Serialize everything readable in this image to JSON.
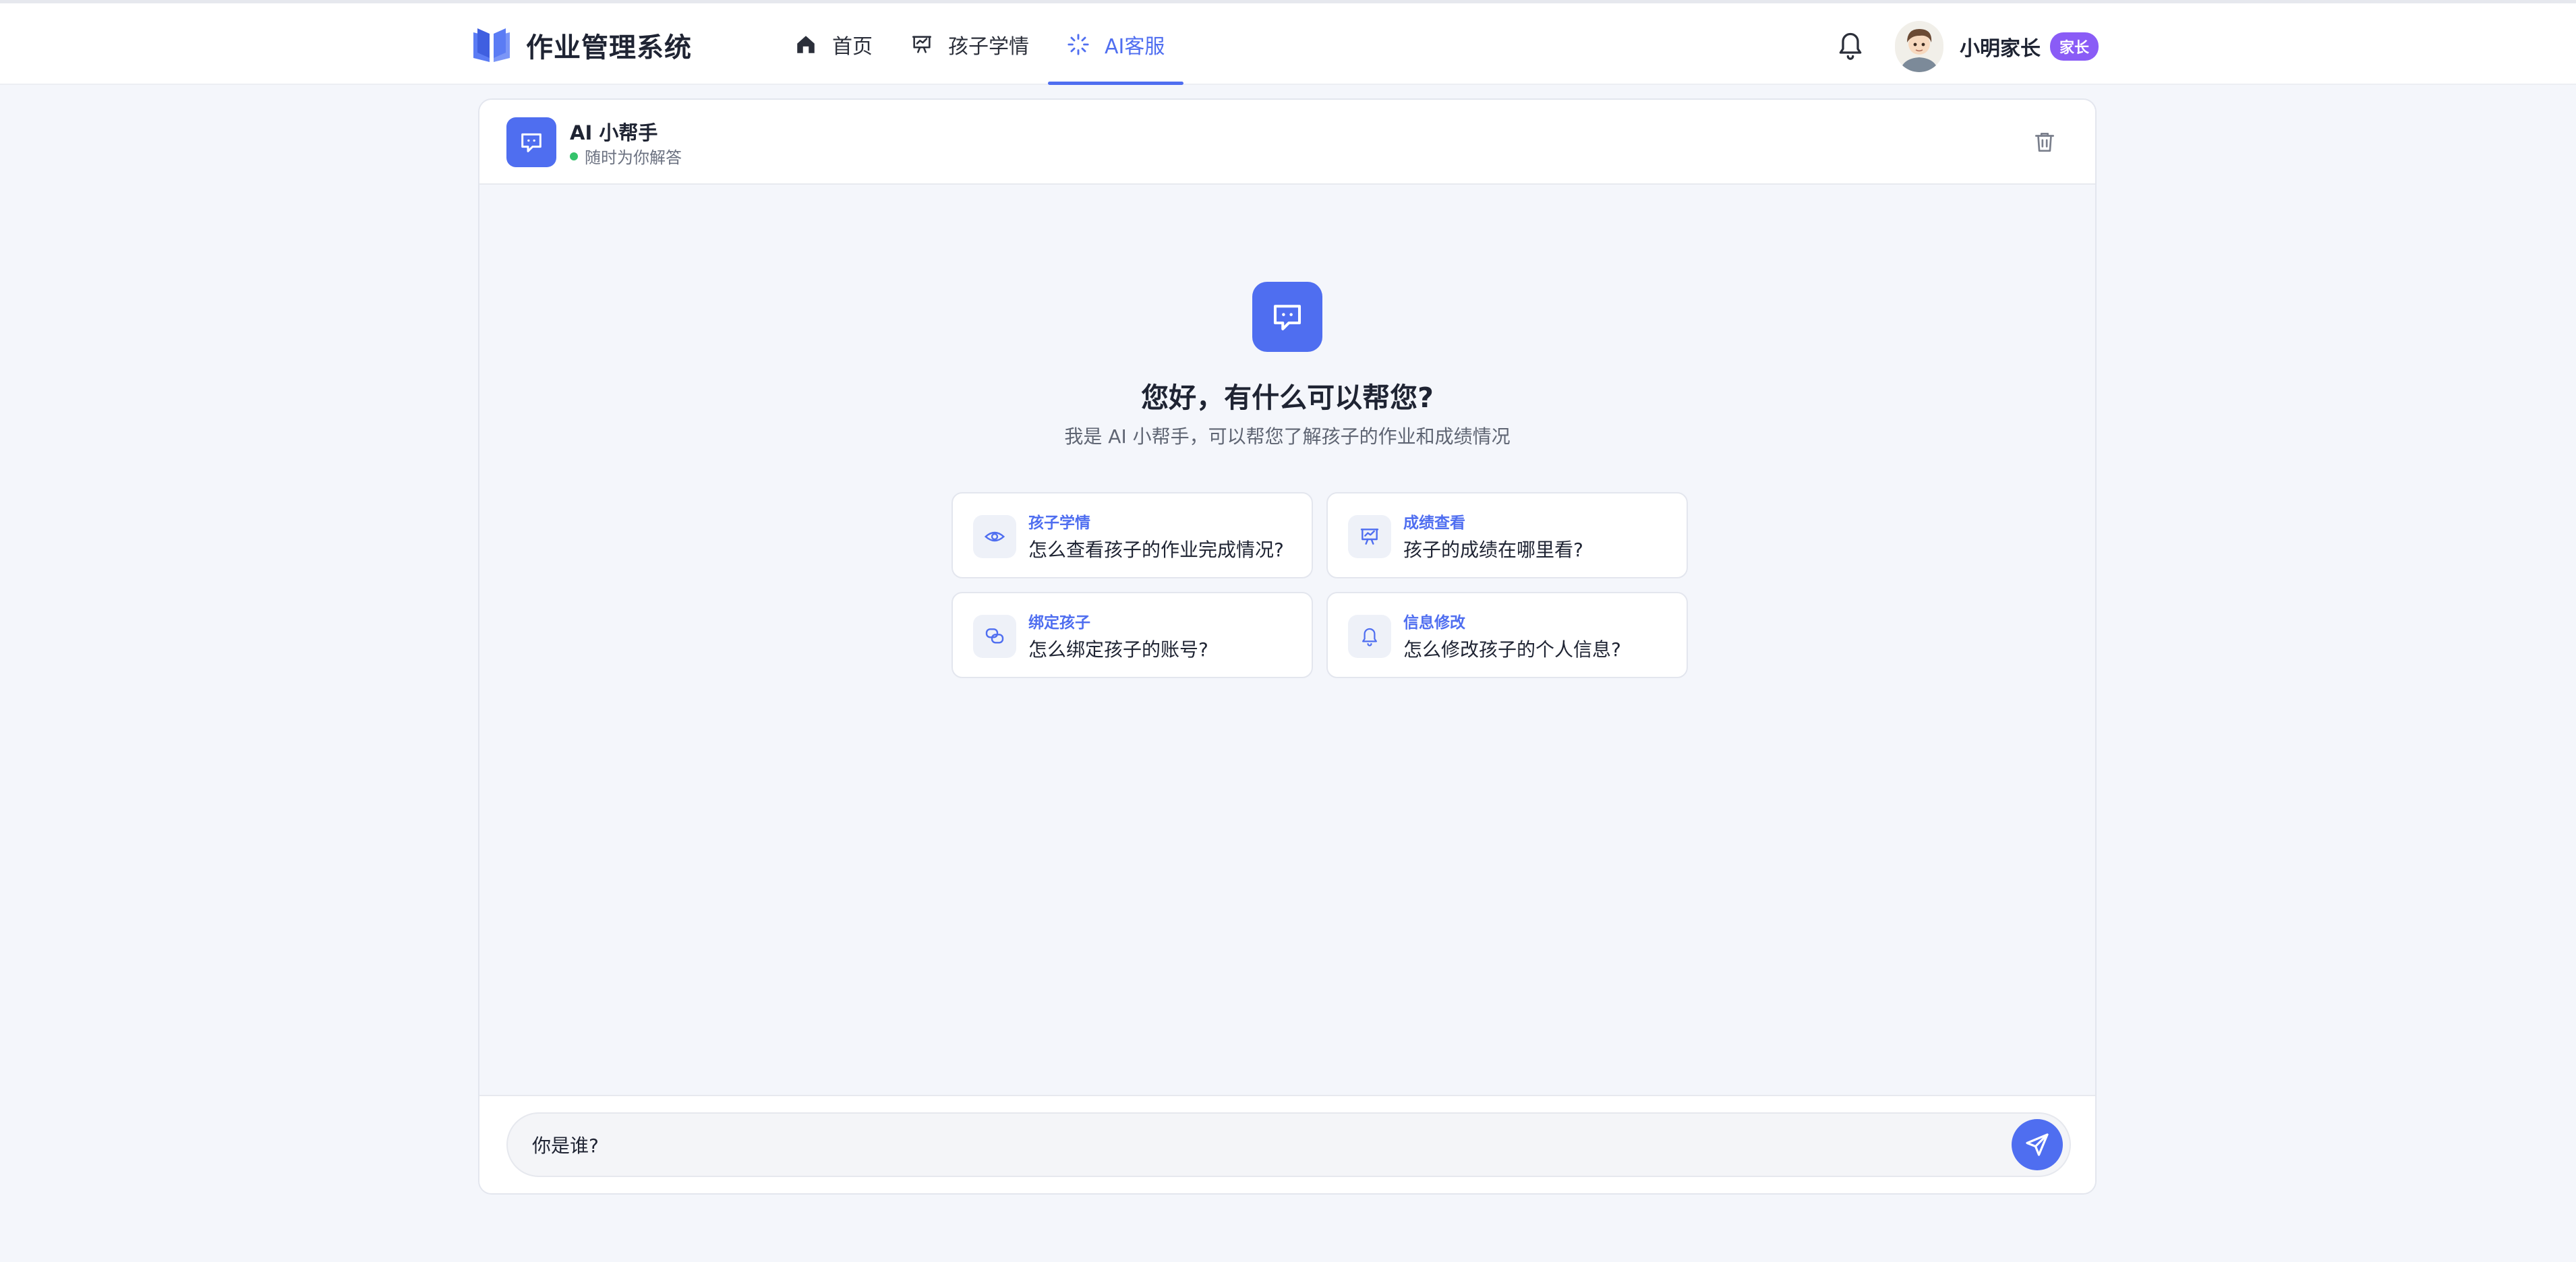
{
  "app": {
    "title": "作业管理系统"
  },
  "nav": {
    "items": [
      {
        "label": "首页",
        "icon": "home-icon",
        "active": false
      },
      {
        "label": "孩子学情",
        "icon": "presentation-chart-icon",
        "active": false
      },
      {
        "label": "AI客服",
        "icon": "sparkle-loader-icon",
        "active": true
      }
    ]
  },
  "user": {
    "name": "小明家长",
    "role": "家长"
  },
  "chat": {
    "bot_name": "AI 小帮手",
    "bot_status": "随时为你解答",
    "welcome_title": "您好，有什么可以帮您?",
    "welcome_subtitle": "我是 AI 小帮手，可以帮您了解孩子的作业和成绩情况",
    "suggestions": [
      {
        "tag": "孩子学情",
        "question": "怎么查看孩子的作业完成情况?",
        "icon": "eye-icon"
      },
      {
        "tag": "成绩查看",
        "question": "孩子的成绩在哪里看?",
        "icon": "presentation-chart-icon"
      },
      {
        "tag": "绑定孩子",
        "question": "怎么绑定孩子的账号?",
        "icon": "chat-bubbles-icon"
      },
      {
        "tag": "信息修改",
        "question": "怎么修改孩子的个人信息?",
        "icon": "bell-icon"
      }
    ],
    "input_value": "你是谁?"
  },
  "colors": {
    "accent": "#4f6ef0",
    "badge": "#8a5cf6",
    "online": "#34c36b"
  }
}
